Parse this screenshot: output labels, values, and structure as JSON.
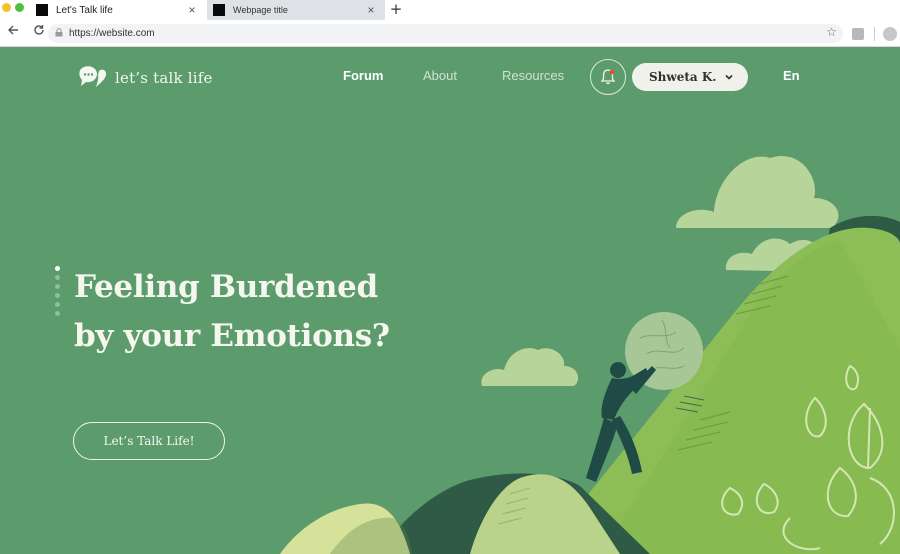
{
  "browser": {
    "tabs": [
      {
        "title": "Let's Talk life",
        "active": true
      },
      {
        "title": "Webpage title",
        "active": false
      }
    ],
    "new_tab_symbol": "+",
    "close_symbol": "×",
    "url": "https://website.com",
    "icons": [
      "back-arrow-icon",
      "reload-icon",
      "lock-icon",
      "star-icon",
      "extension-icon",
      "profile-icon"
    ]
  },
  "site": {
    "brand": "let’s talk life",
    "nav": {
      "forum": "Forum",
      "about": "About",
      "resources": "Resources"
    },
    "user_name": "Shweta K.",
    "language": "En",
    "hero": {
      "line1": "Feeling Burdened",
      "line2": "by your Emotions?",
      "cta": "Let’s Talk Life!",
      "slides_total": 6,
      "active_slide": 1
    },
    "colors": {
      "background": "#5b9b6c",
      "hill_light": "#a9cd78",
      "hill_mid": "#8dbd57",
      "hill_dark": "#2f5a45",
      "cloud": "#b7d49a",
      "notification_dot": "#e04b3a"
    }
  }
}
